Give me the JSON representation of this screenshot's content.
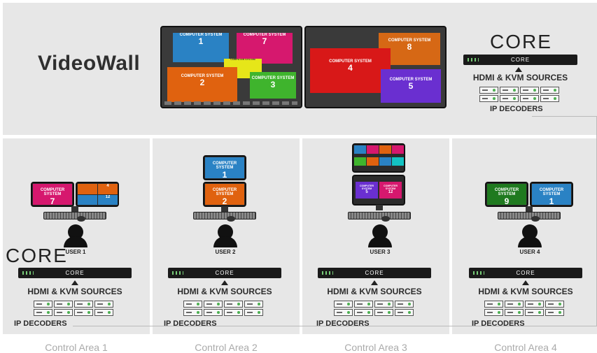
{
  "videowall": {
    "title": "VideoWall",
    "left_screen_tiles": [
      {
        "label": "COMPUTER SYSTEM",
        "number": "1",
        "color": "#2a82c4"
      },
      {
        "label": "COMPUTER SYSTEM",
        "number": "7",
        "color": "#d6186e"
      },
      {
        "label": "COMPUTER SYSTEM",
        "number": "",
        "color": "#e6e619"
      },
      {
        "label": "COMPUTER SYSTEM",
        "number": "2",
        "color": "#e0620f"
      },
      {
        "label": "COMPUTER SYSTEM",
        "number": "3",
        "color": "#3fb42d"
      }
    ],
    "right_screen_tiles": [
      {
        "label": "COMPUTER SYSTEM",
        "number": "8",
        "color": "#d66815"
      },
      {
        "label": "COMPUTER SYSTEM",
        "number": "4",
        "color": "#d81818"
      },
      {
        "label": "COMPUTER SYSTEM",
        "number": "5",
        "color": "#6a2fd0"
      }
    ],
    "core_logo": "CORE",
    "sources_label": "HDMI & KVM SOURCES",
    "decoders_label": "IP DECODERS"
  },
  "areas": [
    {
      "area_label": "Control Area 1",
      "user_label": "USER 1",
      "sources_label": "HDMI & KVM SOURCES",
      "decoders_label": "IP DECODERS",
      "core_logo": "CORE",
      "tiles": [
        {
          "label": "COMPUTER SYSTEM",
          "number": "7",
          "color": "#d6186e"
        },
        {
          "label": "",
          "number": "",
          "color": "#e0620f"
        },
        {
          "label": "",
          "number": "4",
          "color": "#e0620f"
        },
        {
          "label": "",
          "number": "",
          "color": "#2a82c4"
        },
        {
          "label": "",
          "number": "12",
          "color": "#2a82c4"
        }
      ]
    },
    {
      "area_label": "Control Area 2",
      "user_label": "USER 2",
      "sources_label": "HDMI & KVM SOURCES",
      "decoders_label": "IP DECODERS",
      "tiles": [
        {
          "label": "COMPUTER SYSTEM",
          "number": "1",
          "color": "#2a82c4"
        },
        {
          "label": "COMPUTER SYSTEM",
          "number": "2",
          "color": "#e0620f"
        }
      ]
    },
    {
      "area_label": "Control Area 3",
      "user_label": "USER 3",
      "sources_label": "HDMI & KVM SOURCES",
      "decoders_label": "IP DECODERS",
      "tiles": [
        {
          "label": "",
          "number": "",
          "color": "#2a82c4"
        },
        {
          "label": "",
          "number": "",
          "color": "#d6186e"
        },
        {
          "label": "",
          "number": "",
          "color": "#e0620f"
        },
        {
          "label": "",
          "number": "",
          "color": "#d6186e"
        },
        {
          "label": "",
          "number": "",
          "color": "#3fb42d"
        },
        {
          "label": "",
          "number": "",
          "color": "#e0620f"
        },
        {
          "label": "",
          "number": "",
          "color": "#2a82c4"
        },
        {
          "label": "",
          "number": "",
          "color": "#13c3c3"
        },
        {
          "label": "COMPUTER SYSTEM",
          "number": "5",
          "color": "#6a2fd0"
        },
        {
          "label": "COMPUTER SYSTEM",
          "number": "12",
          "color": "#d6186e"
        }
      ]
    },
    {
      "area_label": "Control Area 4",
      "user_label": "USER 4",
      "sources_label": "HDMI & KVM SOURCES",
      "decoders_label": "IP DECODERS",
      "tiles": [
        {
          "label": "COMPUTER SYSTEM",
          "number": "9",
          "color": "#1f7a1f"
        },
        {
          "label": "COMPUTER SYSTEM",
          "number": "1",
          "color": "#2a82c4"
        }
      ]
    }
  ],
  "device_label": "CORE"
}
